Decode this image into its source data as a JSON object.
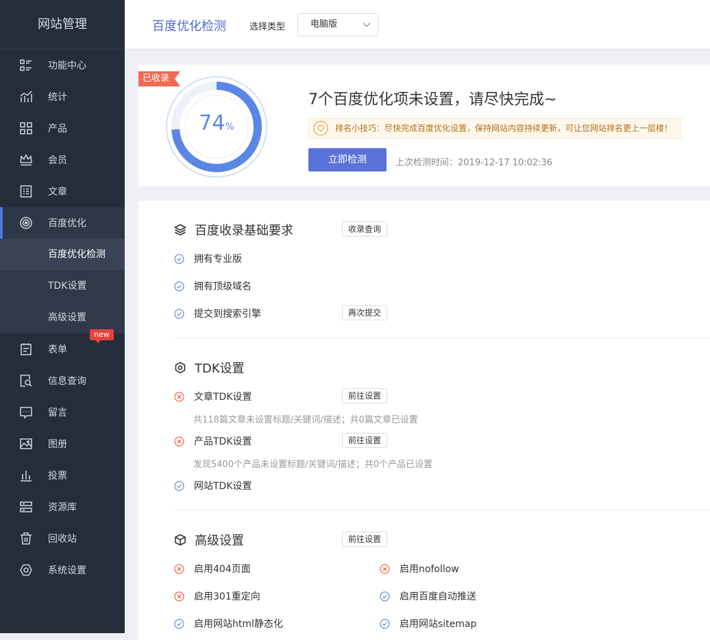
{
  "sidebar": {
    "title": "网站管理",
    "items": [
      {
        "label": "功能中心",
        "icon": "grid-list-icon"
      },
      {
        "label": "统计",
        "icon": "chart-icon"
      },
      {
        "label": "产品",
        "icon": "apps-icon"
      },
      {
        "label": "会员",
        "icon": "crown-icon"
      },
      {
        "label": "文章",
        "icon": "article-icon"
      },
      {
        "label": "百度优化",
        "icon": "target-icon"
      },
      {
        "label": "表单",
        "icon": "form-icon"
      },
      {
        "label": "信息查询",
        "icon": "search-doc-icon"
      },
      {
        "label": "留言",
        "icon": "message-icon"
      },
      {
        "label": "图册",
        "icon": "image-icon"
      },
      {
        "label": "投票",
        "icon": "bars-icon"
      },
      {
        "label": "资源库",
        "icon": "storage-icon"
      },
      {
        "label": "回收站",
        "icon": "trash-icon"
      },
      {
        "label": "系统设置",
        "icon": "settings-icon"
      }
    ],
    "subitems": [
      "百度优化检测",
      "TDK设置",
      "高级设置"
    ],
    "new_badge": "new"
  },
  "header": {
    "title": "百度优化检测",
    "type_label": "选择类型",
    "type_value": "电脑版"
  },
  "summary": {
    "ribbon": "已收录",
    "score": "74",
    "score_unit": "%",
    "score_fraction": 0.74,
    "headline": "7个百度优化项未设置，请尽快完成~",
    "tip": "排名小技巧：尽快完成百度优化设置，保持网站内容持续更新，可让您网站排名更上一层楼！",
    "detect_button": "立即检测",
    "last_check": "上次检测时间：2019-12-17 10:02:36"
  },
  "sections": {
    "basic": {
      "title": "百度收录基础要求",
      "button": "收录查询",
      "items": [
        {
          "label": "拥有专业版",
          "status": "ok"
        },
        {
          "label": "拥有顶级域名",
          "status": "ok"
        },
        {
          "label": "提交到搜索引擎",
          "status": "ok",
          "button": "再次提交"
        }
      ]
    },
    "tdk": {
      "title": "TDK设置",
      "items": [
        {
          "label": "文章TDK设置",
          "status": "error",
          "button": "前往设置",
          "desc": "共118篇文章未设置标题/关键词/描述；共0篇文章已设置"
        },
        {
          "label": "产品TDK设置",
          "status": "error",
          "button": "前往设置",
          "desc": "发现5400个产品未设置标题/关键词/描述；共0个产品已设置"
        },
        {
          "label": "网站TDK设置",
          "status": "ok"
        }
      ]
    },
    "advanced": {
      "title": "高级设置",
      "button": "前往设置",
      "items": [
        {
          "label": "启用404页面",
          "status": "error"
        },
        {
          "label": "启用nofollow",
          "status": "error"
        },
        {
          "label": "启用301重定向",
          "status": "error"
        },
        {
          "label": "启用百度自动推送",
          "status": "ok"
        },
        {
          "label": "启用网站html静态化",
          "status": "ok"
        },
        {
          "label": "启用网站sitemap",
          "status": "ok"
        }
      ]
    }
  },
  "colors": {
    "accent": "#5b72d9",
    "ok": "#6c8fd8",
    "error": "#f06b53",
    "sidebar_bg": "#262d3a"
  }
}
